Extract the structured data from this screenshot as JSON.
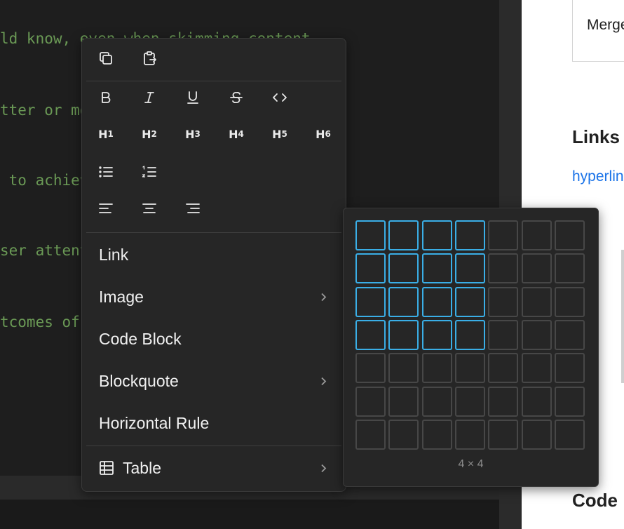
{
  "editor": {
    "lines": [
      "ld know, even when skimming content",
      "tter or mo",
      " to achiev",
      "ser attent",
      "tcomes of "
    ]
  },
  "preview": {
    "merge_text": "Merge",
    "links_heading": "Links",
    "hyperlink_text": "hyperlin",
    "code_heading": "Code I"
  },
  "context_menu": {
    "clipboard": [
      {
        "name": "copy-icon"
      },
      {
        "name": "paste-icon"
      }
    ],
    "formatting": [
      {
        "name": "bold-icon"
      },
      {
        "name": "italic-icon"
      },
      {
        "name": "underline-icon"
      },
      {
        "name": "strikethrough-icon"
      },
      {
        "name": "code-icon"
      }
    ],
    "headings": [
      {
        "h": "H",
        "n": "1"
      },
      {
        "h": "H",
        "n": "2"
      },
      {
        "h": "H",
        "n": "3"
      },
      {
        "h": "H",
        "n": "4"
      },
      {
        "h": "H",
        "n": "5"
      },
      {
        "h": "H",
        "n": "6"
      }
    ],
    "lists": [
      {
        "name": "bullet-list-icon"
      },
      {
        "name": "numbered-list-icon"
      }
    ],
    "alignment": [
      {
        "name": "align-left-icon"
      },
      {
        "name": "align-center-icon"
      },
      {
        "name": "align-right-icon"
      }
    ],
    "items": {
      "link": "Link",
      "image": "Image",
      "code_block": "Code Block",
      "blockquote": "Blockquote",
      "horizontal_rule": "Horizontal Rule",
      "table": "Table"
    }
  },
  "table_picker": {
    "rows": 7,
    "cols": 7,
    "selected_rows": 4,
    "selected_cols": 4,
    "size_label": "4 × 4",
    "accent_color": "#3aaee6"
  }
}
